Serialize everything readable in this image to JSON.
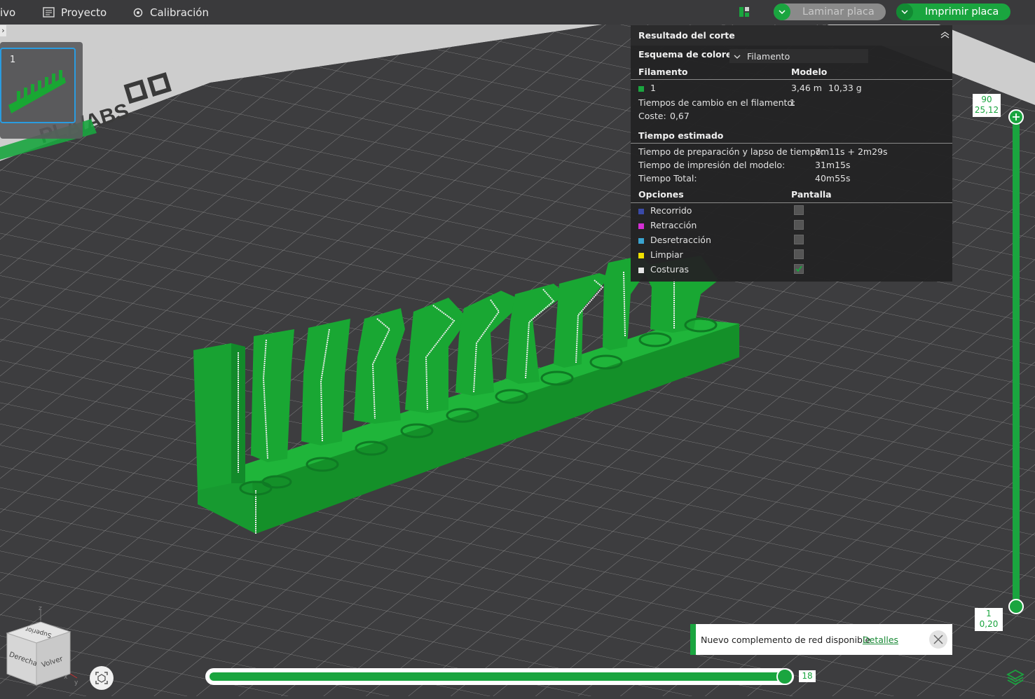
{
  "menu": {
    "file_partial": "ivo",
    "project": "Proyecto",
    "calibration": "Calibración"
  },
  "toolbar": {
    "slice_label": "Laminar placa",
    "print_label": "Imprimir placa"
  },
  "plate": {
    "number": "1",
    "bed_brand_text": "PLA/ABS"
  },
  "result_panel": {
    "title": "Resultado del corte",
    "color_scheme_label": "Esquema de colores",
    "color_scheme_value": "Filamento",
    "col_filament": "Filamento",
    "col_model": "Modelo",
    "filament_id": "1",
    "filament_length": "3,46 m",
    "filament_weight": "10,33 g",
    "filament_changes_label": "Tiempos de cambio en el filamento:",
    "filament_changes_value": "1",
    "cost_label": "Coste:",
    "cost_value": "0,67",
    "time_header": "Tiempo estimado",
    "prep_label": "Tiempo de preparación y lapso de tiempo:",
    "prep_value": "7m11s + 2m29s",
    "model_time_label": "Tiempo de impresión del modelo:",
    "model_time_value": "31m15s",
    "total_label": "Tiempo Total:",
    "total_value": "40m55s",
    "options_header": "Opciones",
    "display_header": "Pantalla",
    "options": [
      {
        "label": "Recorrido",
        "color": "#3a4aa8",
        "checked": false
      },
      {
        "label": "Retracción",
        "color": "#d52fd5",
        "checked": false
      },
      {
        "label": "Desretracción",
        "color": "#3aa4d0",
        "checked": false
      },
      {
        "label": "Limpiar",
        "color": "#f0e000",
        "checked": false
      },
      {
        "label": "Costuras",
        "color": "#e6e6e6",
        "checked": true
      }
    ],
    "filament_color": "#1aa53f"
  },
  "layer_slider": {
    "top_layer": "90",
    "top_height": "25,12",
    "bottom_layer": "1",
    "bottom_height": "0,20"
  },
  "move_slider": {
    "value": "18",
    "fraction": 0.99
  },
  "view_cube": {
    "top": "Superior",
    "left": "Derecha",
    "front": "Volver",
    "axis_z": "z",
    "axis_x": "x",
    "axis_y": "y"
  },
  "notification": {
    "text": "Nuevo complemento de red disponible",
    "link": "Detalles"
  },
  "colors": {
    "accent": "#1aa53f",
    "model_green": "#17a131",
    "background": "#3d3d3f",
    "panel": "#232324"
  }
}
